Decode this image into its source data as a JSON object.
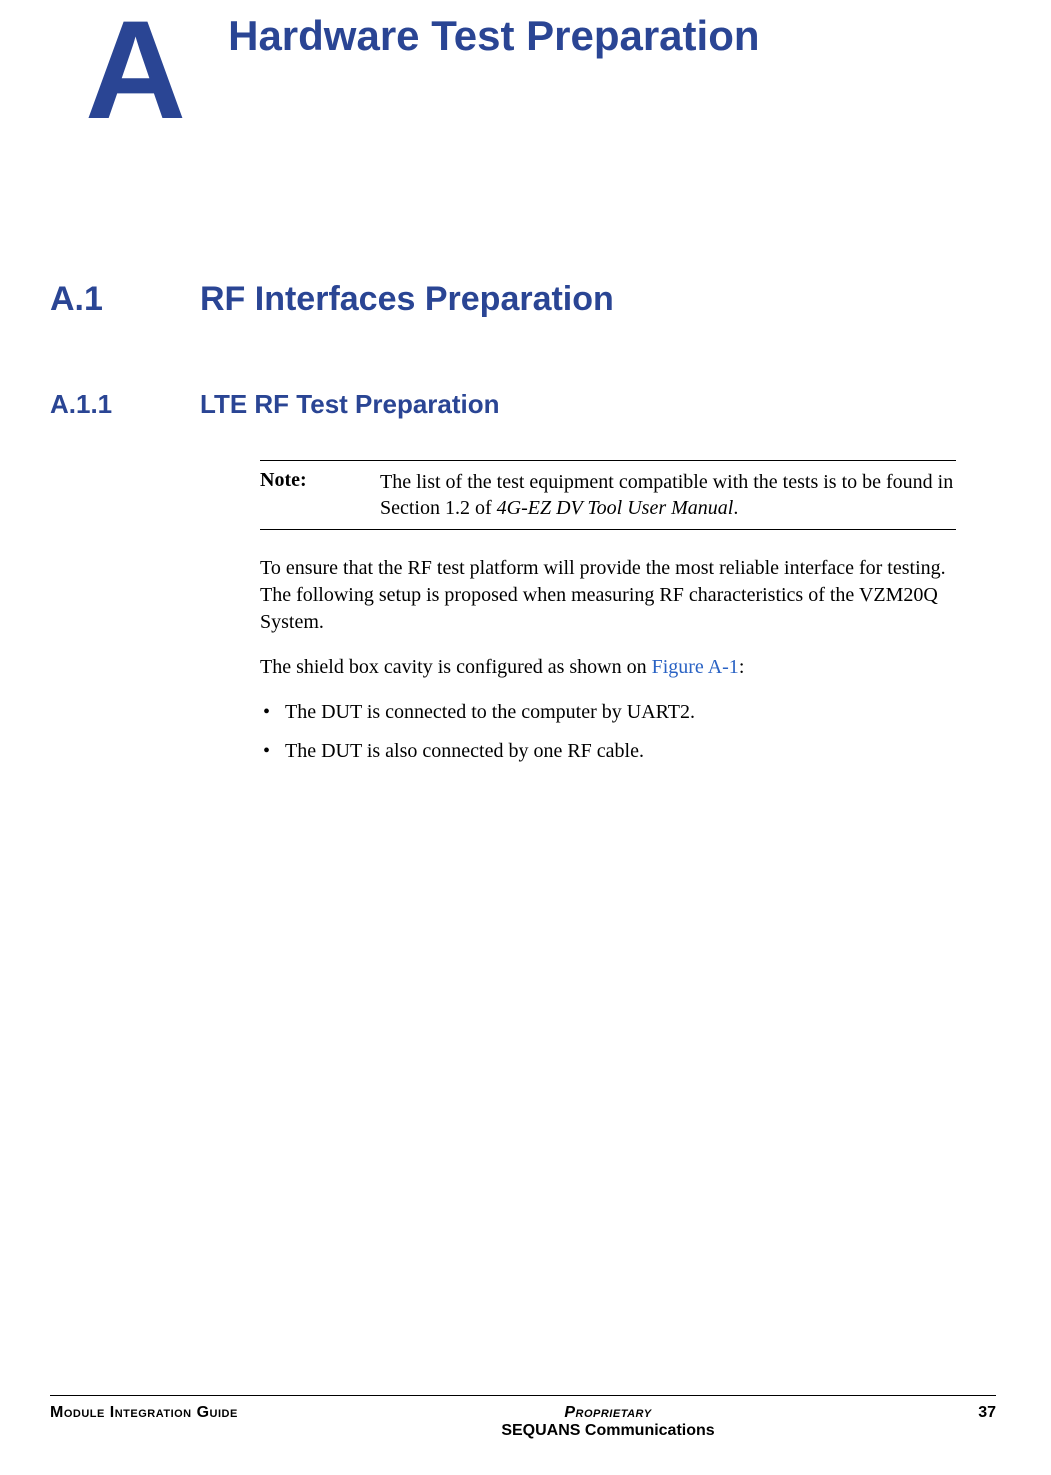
{
  "appendix": {
    "letter": "A",
    "title": "Hardware Test Preparation"
  },
  "section": {
    "number": "A.1",
    "title": "RF Interfaces Preparation"
  },
  "subsection": {
    "number": "A.1.1",
    "title": "LTE RF Test Preparation"
  },
  "note": {
    "label": "Note:",
    "text_before_italic": "The list of the test equipment compatible with the tests is to be found in Section 1.2 of ",
    "italic_text": "4G-EZ DV Tool User Manual",
    "text_after_italic": "."
  },
  "paragraphs": {
    "p1": "To ensure that the RF test platform will provide the most reliable interface for testing. The following setup is proposed when measuring RF characteristics of the VZM20Q System.",
    "p2_before_link": "The shield box cavity is configured as shown on ",
    "p2_link": "Figure A-1",
    "p2_after_link": ":"
  },
  "bullets": {
    "b1": "The DUT is connected to the computer by UART2.",
    "b2": "The DUT is also connected by one RF cable."
  },
  "footer": {
    "left": "Module Integration Guide",
    "center_top": "Proprietary",
    "center_bottom": "SEQUANS Communications",
    "page_number": "37"
  }
}
